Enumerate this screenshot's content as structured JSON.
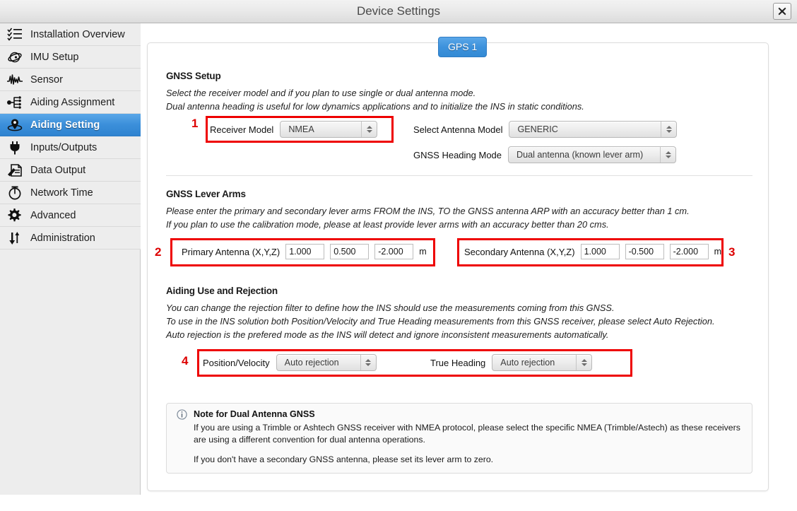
{
  "window": {
    "title": "Device Settings",
    "close_label": "close-icon"
  },
  "sidebar": {
    "items": [
      {
        "label": "Installation Overview",
        "icon": "checklist-icon",
        "active": false
      },
      {
        "label": "IMU Setup",
        "icon": "imu-icon",
        "active": false
      },
      {
        "label": "Sensor",
        "icon": "waveform-icon",
        "active": false
      },
      {
        "label": "Aiding Assignment",
        "icon": "node-tree-icon",
        "active": false
      },
      {
        "label": "Aiding Setting",
        "icon": "location-pin-icon",
        "active": true
      },
      {
        "label": "Inputs/Outputs",
        "icon": "plug-icon",
        "active": false
      },
      {
        "label": "Data Output",
        "icon": "document-pencil-icon",
        "active": false
      },
      {
        "label": "Network Time",
        "icon": "stopwatch-icon",
        "active": false
      },
      {
        "label": "Advanced",
        "icon": "gear-icon",
        "active": false
      },
      {
        "label": "Administration",
        "icon": "up-down-arrows-icon",
        "active": false
      }
    ]
  },
  "tab": {
    "label": "GPS 1"
  },
  "gnss_setup": {
    "title": "GNSS Setup",
    "desc_line1": "Select the receiver model and if you plan to use single or dual antenna mode.",
    "desc_line2": "Dual antenna heading is useful for low dynamics applications and to initialize the INS in static conditions.",
    "receiver_model_label": "Receiver Model",
    "receiver_model_value": "NMEA",
    "antenna_model_label": "Select Antenna Model",
    "antenna_model_value": "GENERIC",
    "heading_mode_label": "GNSS Heading Mode",
    "heading_mode_value": "Dual antenna (known lever arm)"
  },
  "lever_arms": {
    "title": "GNSS Lever Arms",
    "desc_line1": "Please enter the primary and secondary lever arms FROM the INS, TO the GNSS antenna ARP with an accuracy better than 1 cm.",
    "desc_line2": "If you plan to use the calibration mode, please at least provide lever arms with an accuracy better than 20 cms.",
    "primary_label": "Primary Antenna (X,Y,Z)",
    "primary_x": "1.000",
    "primary_y": "0.500",
    "primary_z": "-2.000",
    "primary_unit": "m",
    "secondary_label": "Secondary Antenna (X,Y,Z)",
    "secondary_x": "1.000",
    "secondary_y": "-0.500",
    "secondary_z": "-2.000",
    "secondary_unit": "m"
  },
  "rejection": {
    "title": "Aiding Use and Rejection",
    "desc_line1": "You can change the rejection filter to define how the INS should use the measurements coming from this GNSS.",
    "desc_line2": "To use in the INS solution both Position/Velocity and True Heading measurements from this GNSS receiver, please select Auto Rejection.",
    "desc_line3": "Auto rejection is the prefered mode as the INS will detect and ignore inconsistent measurements automatically.",
    "posvel_label": "Position/Velocity",
    "posvel_value": "Auto rejection",
    "heading_label": "True Heading",
    "heading_value": "Auto rejection"
  },
  "note": {
    "icon": "info-icon",
    "title": "Note for Dual Antenna GNSS",
    "para1": "If you are using a Trimble or Ashtech GNSS receiver with NMEA protocol, please select the specific NMEA (Trimble/Astech) as these receivers are using a different convention for dual antenna operations.",
    "para2": "If you don't have a secondary GNSS antenna, please set its lever arm to zero."
  },
  "annotations": {
    "marker1": "1",
    "marker2": "2",
    "marker3": "3",
    "marker4": "4",
    "color": "#ee0000"
  }
}
